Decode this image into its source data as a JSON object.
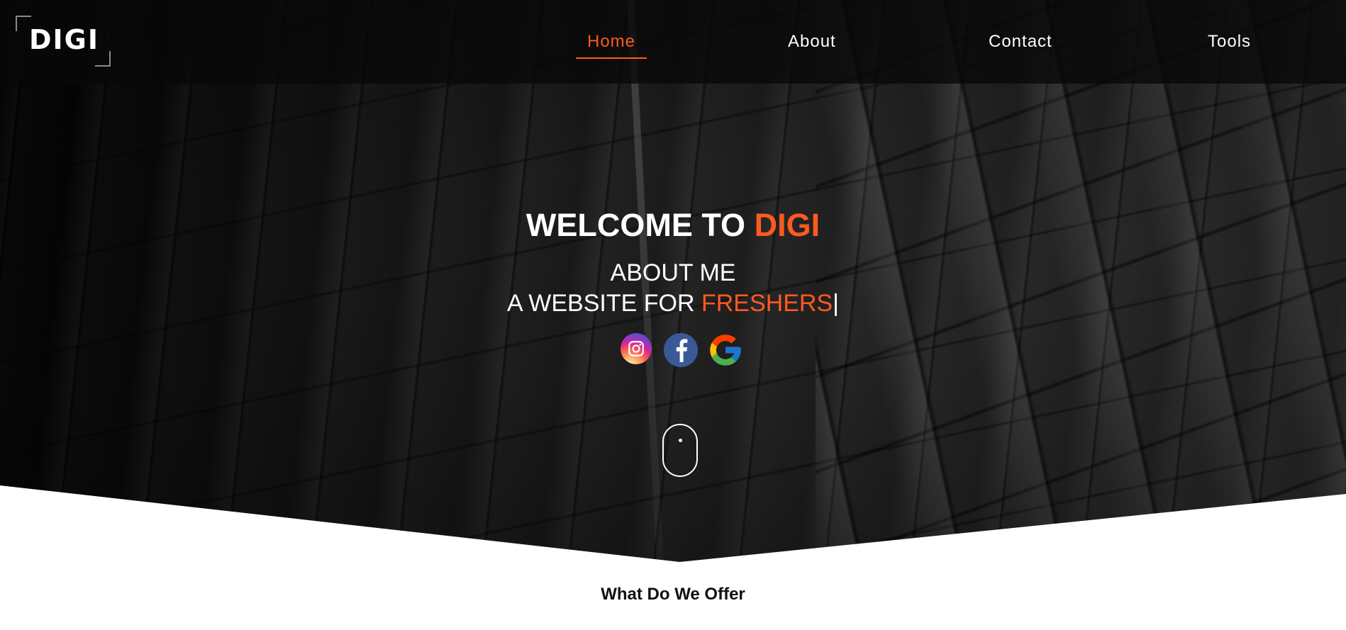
{
  "brand": {
    "logo_text": "DIGI"
  },
  "nav": {
    "items": [
      {
        "label": "Home",
        "active": true
      },
      {
        "label": "About",
        "active": false
      },
      {
        "label": "Contact",
        "active": false
      },
      {
        "label": "Tools",
        "active": false
      }
    ]
  },
  "hero": {
    "title_prefix": "WELCOME TO ",
    "title_accent": "DIGI",
    "subtitle": "ABOUT ME",
    "typing_prefix": "A WEBSITE FOR ",
    "typing_accent": "FRESHERS",
    "cursor": "|",
    "socials": [
      {
        "name": "Instagram",
        "icon": "instagram-icon"
      },
      {
        "name": "Facebook",
        "icon": "facebook-icon"
      },
      {
        "name": "Google",
        "icon": "google-icon"
      }
    ],
    "scroll_icon": "mouse-scroll-icon"
  },
  "offer": {
    "title": "What Do We Offer"
  },
  "colors": {
    "accent": "#ff5a1f",
    "header_bg": "#080808",
    "text": "#ffffff"
  }
}
